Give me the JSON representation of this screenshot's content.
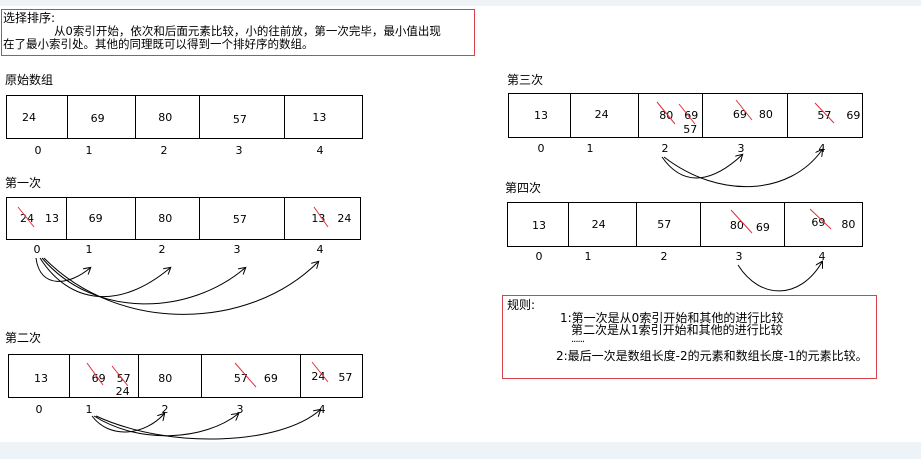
{
  "intro": {
    "heading": "选择排序:",
    "line1": "从0索引开始，依次和后面元素比较，小的往前放，第一次完毕，最小值出现",
    "line2": "在了最小索引处。其他的同理既可以得到一个排好序的数组。"
  },
  "panels": {
    "original": {
      "title": "原始数组",
      "values": [
        "24",
        "69",
        "80",
        "57",
        "13"
      ],
      "indices": [
        "0",
        "1",
        "2",
        "3",
        "4"
      ]
    },
    "pass1": {
      "title": "第一次",
      "cells": [
        [
          "24",
          "13"
        ],
        [
          "69"
        ],
        [
          "80"
        ],
        [
          "57"
        ],
        [
          "13",
          "24"
        ]
      ],
      "indices": [
        "0",
        "1",
        "2",
        "3",
        "4"
      ]
    },
    "pass2": {
      "title": "第二次",
      "cells": [
        [
          "13"
        ],
        [
          "69",
          "57",
          "24"
        ],
        [
          "80"
        ],
        [
          "57",
          "69"
        ],
        [
          "24",
          "57"
        ]
      ],
      "indices": [
        "0",
        "1",
        "2",
        "3",
        "4"
      ]
    },
    "pass3": {
      "title": "第三次",
      "cells": [
        [
          "13"
        ],
        [
          "24"
        ],
        [
          "80",
          "69",
          "57"
        ],
        [
          "69",
          "80"
        ],
        [
          "57",
          "69"
        ]
      ],
      "indices": [
        "0",
        "1",
        "2",
        "3",
        "4"
      ]
    },
    "pass4": {
      "title": "第四次",
      "cells": [
        [
          "13"
        ],
        [
          "24"
        ],
        [
          "57"
        ],
        [
          "80",
          "69"
        ],
        [
          "69",
          "80"
        ]
      ],
      "indices": [
        "0",
        "1",
        "2",
        "3",
        "4"
      ]
    }
  },
  "rules": {
    "title": "规则:",
    "rule1a": "1:第一次是从0索引开始和其他的进行比较",
    "rule1b": "第二次是从1索引开始和其他的进行比较",
    "ellipsis": "......",
    "rule2": "2:最后一次是数组长度-2的元素和数组长度-1的元素比较。"
  },
  "colors": {
    "box_border": "#d8404a",
    "strike": "#e0303a"
  }
}
